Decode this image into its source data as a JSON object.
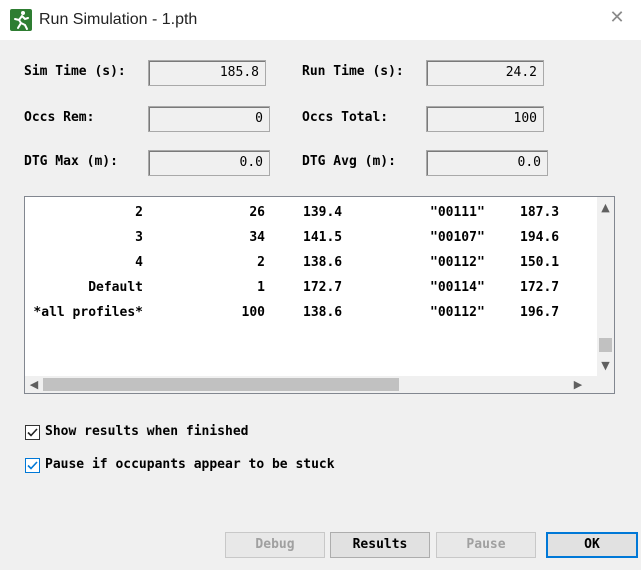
{
  "window": {
    "title": "Run Simulation - 1.pth",
    "close_glyph": "✕",
    "icon": "running-man-icon"
  },
  "stats": {
    "sim_time_label": "Sim Time (s):",
    "sim_time_value": "185.8",
    "run_time_label": "Run Time (s):",
    "run_time_value": "24.2",
    "occs_rem_label": "Occs Rem:",
    "occs_rem_value": "0",
    "occs_total_label": "Occs Total:",
    "occs_total_value": "100",
    "dtg_max_label": "DTG Max (m):",
    "dtg_max_value": "0.0",
    "dtg_avg_label": "DTG Avg (m):",
    "dtg_avg_value": "0.0"
  },
  "results": {
    "rows": [
      [
        "2",
        "26",
        "139.4",
        "\"00111\"",
        "187.3"
      ],
      [
        "3",
        "34",
        "141.5",
        "\"00107\"",
        "194.6"
      ],
      [
        "4",
        "2",
        "138.6",
        "\"00112\"",
        "150.1"
      ],
      [
        "Default",
        "1",
        "172.7",
        "\"00114\"",
        "172.7"
      ],
      [
        "*all profiles*",
        "100",
        "138.6",
        "\"00112\"",
        "196.7"
      ]
    ]
  },
  "options": {
    "show_results_label": "Show results when finished",
    "show_results_checked": true,
    "pause_stuck_label": "Pause if occupants appear to be stuck",
    "pause_stuck_checked": true
  },
  "buttons": {
    "debug": "Debug",
    "results": "Results",
    "pause": "Pause",
    "ok": "OK"
  },
  "colors": {
    "accent": "#0078d7",
    "icon_green": "#2e7d32"
  }
}
